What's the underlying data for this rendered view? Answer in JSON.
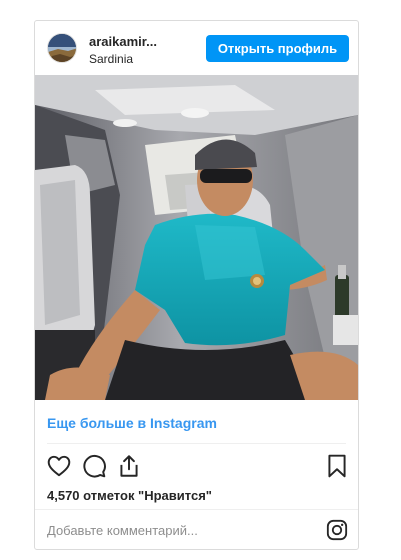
{
  "post": {
    "username": "araikamir...",
    "location": "Sardinia",
    "follow_label": "Открыть профиль",
    "more_link": "Еще больше в Instagram",
    "likes_text": "4,570 отметок \"Нравится\"",
    "comment_placeholder": "Добавьте комментарий..."
  },
  "icons": {
    "like": "heart-outline-icon",
    "comment": "comment-bubble-icon",
    "share": "share-upload-icon",
    "save": "bookmark-outline-icon",
    "brand": "instagram-icon"
  },
  "colors": {
    "accent": "#0095f6",
    "link": "#3897f0"
  }
}
